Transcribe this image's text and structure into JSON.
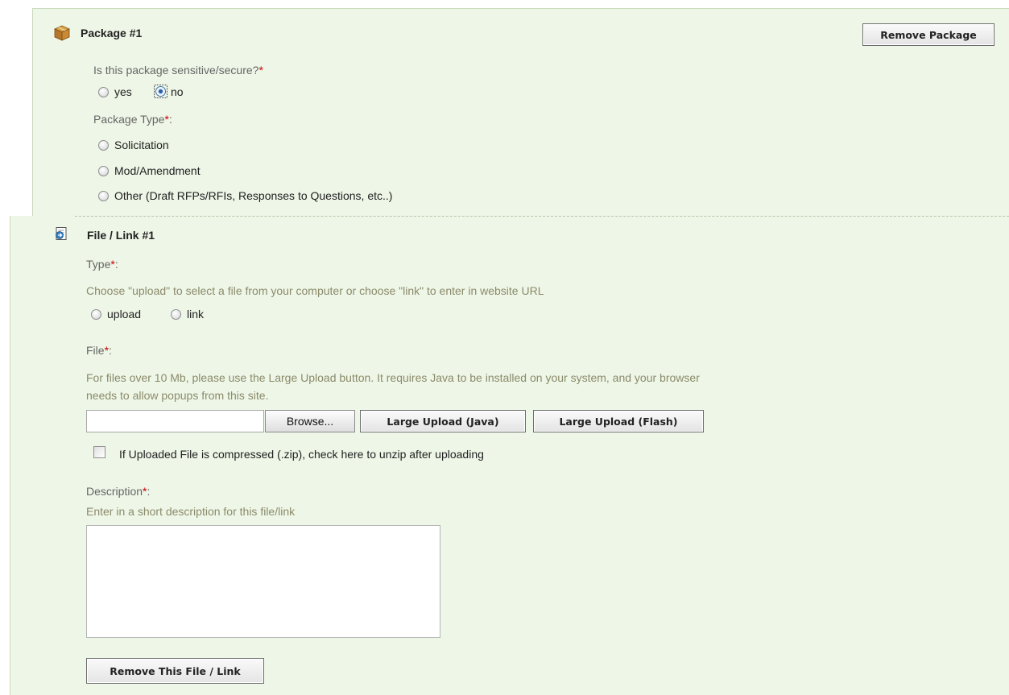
{
  "package": {
    "title": "Package #1",
    "remove_label": "Remove Package",
    "sensitive_label": "Is this package sensitive/secure?",
    "sensitive_options": [
      {
        "label": "yes",
        "selected": false
      },
      {
        "label": "no",
        "selected": true
      }
    ],
    "type_label": "Package Type",
    "type_options": [
      {
        "label": "Solicitation",
        "selected": false
      },
      {
        "label": "Mod/Amendment",
        "selected": false
      },
      {
        "label": "Other (Draft RFPs/RFIs, Responses to Questions, etc..)",
        "selected": false
      }
    ]
  },
  "file_link": {
    "title": "File / Link #1",
    "type_label": "Type",
    "type_hint": "Choose \"upload\" to select a file from your computer or choose \"link\" to enter in website URL",
    "type_options": [
      {
        "label": "upload",
        "selected": false
      },
      {
        "label": "link",
        "selected": false
      }
    ],
    "file_label": "File",
    "file_hint_line1": "For files over 10 Mb, please use the Large Upload button. It requires Java to be installed on your system, and your browser",
    "file_hint_line2": "needs to allow popups from this site.",
    "file_value": "",
    "browse_label": "Browse...",
    "large_upload_java_label": "Large Upload (Java)",
    "large_upload_flash_label": "Large Upload (Flash)",
    "unzip_label": "If Uploaded File is compressed (.zip), check here to unzip after uploading",
    "unzip_checked": false,
    "description_label": "Description",
    "description_hint": "Enter in a short description for this file/link",
    "description_value": "",
    "remove_label": "Remove This File / Link"
  },
  "required_marker": "*",
  "colon": ":",
  "icons": {
    "package": "package-box-icon",
    "file_link": "file-link-icon"
  },
  "colors": {
    "panel_bg": "#eef6e7",
    "required": "#cc0000",
    "hint_text": "#8b8b6a"
  }
}
